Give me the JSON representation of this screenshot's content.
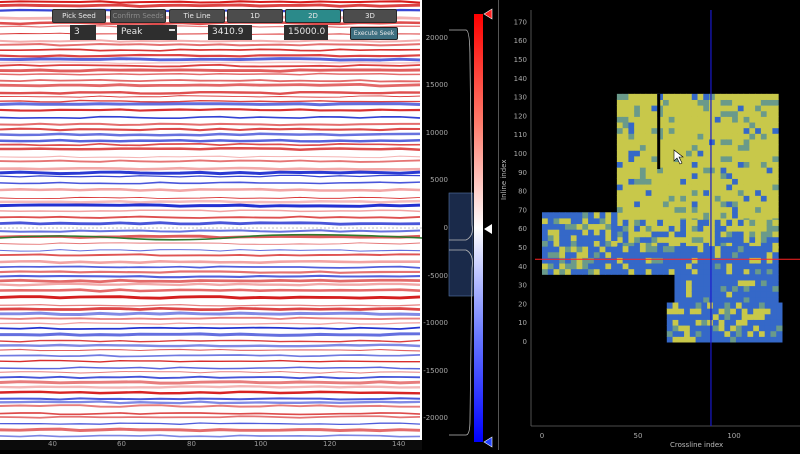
{
  "toolbar": {
    "pick_seed": "Pick Seed",
    "confirm_seeds": "Confirm Seeds",
    "tie_line": "Tie Line",
    "view_1d": "1D",
    "view_2d": "2D",
    "view_3d": "3D"
  },
  "controls": {
    "count_value": "3",
    "event_type_value": "Peak",
    "value_a": "3410.9",
    "value_b": "15000.0",
    "execute_seek": "Execute Seek"
  },
  "seismic": {
    "x_ticks": [
      "40",
      "60",
      "80",
      "100",
      "120",
      "140"
    ]
  },
  "colorbar": {
    "ticks": [
      "20000",
      "15000",
      "10000",
      "5000",
      "0",
      "-5000",
      "-10000",
      "-15000",
      "-20000"
    ],
    "positive_color": "#ff0000",
    "negative_color": "#0000ff"
  },
  "map": {
    "y_ticks": [
      "170",
      "160",
      "150",
      "140",
      "130",
      "120",
      "110",
      "100",
      "90",
      "80",
      "70",
      "60",
      "50",
      "40",
      "30",
      "20",
      "10",
      "0"
    ],
    "x_ticks": [
      "0",
      "50",
      "100"
    ],
    "y_label": "Inline index",
    "x_label": "Crossline index",
    "crosshair_inline": 44,
    "crosshair_crossline": 88,
    "colors": {
      "high": "#c8c84a",
      "low": "#3568c8",
      "mid": "#6a9a8a"
    }
  }
}
